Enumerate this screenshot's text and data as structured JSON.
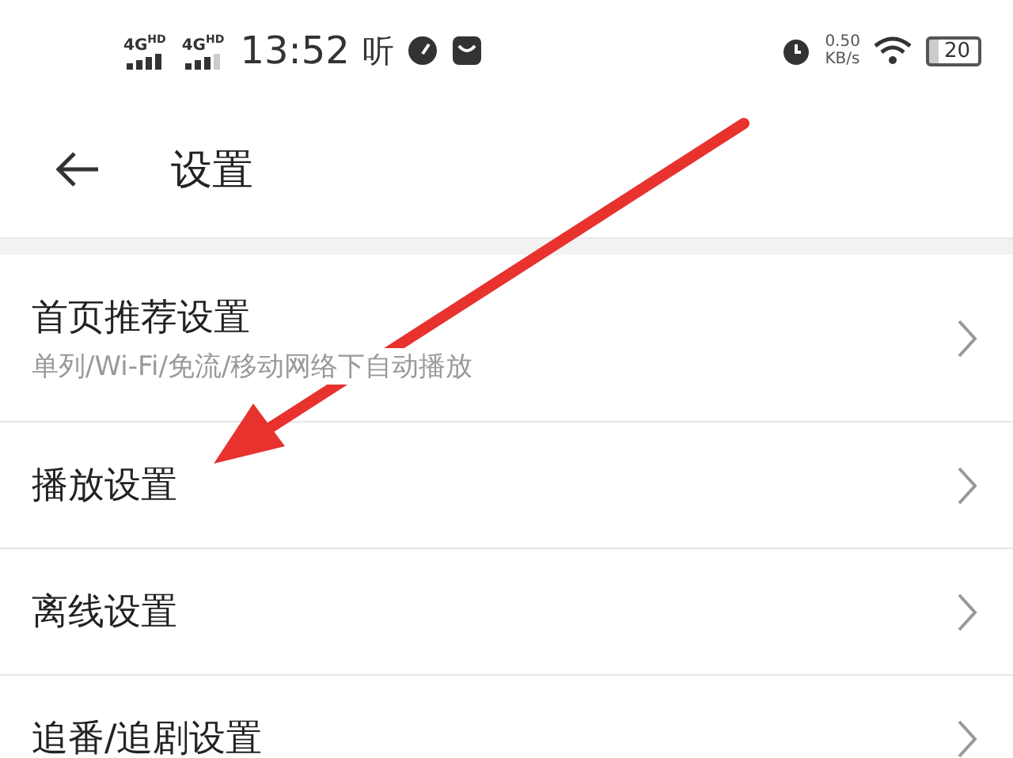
{
  "status_bar": {
    "network_1": "4G",
    "network_1_badge": "HD",
    "network_2": "4G",
    "network_2_badge": "HD",
    "time": "13:52",
    "app_glyph": "听",
    "speed_value": "0.50",
    "speed_unit": "KB/s",
    "battery": "20"
  },
  "header": {
    "title": "设置"
  },
  "settings": [
    {
      "label": "首页推荐设置",
      "subtitle": "单列/Wi-Fi/免流/移动网络下自动播放"
    },
    {
      "label": "播放设置"
    },
    {
      "label": "离线设置"
    },
    {
      "label": "追番/追剧设置"
    }
  ]
}
